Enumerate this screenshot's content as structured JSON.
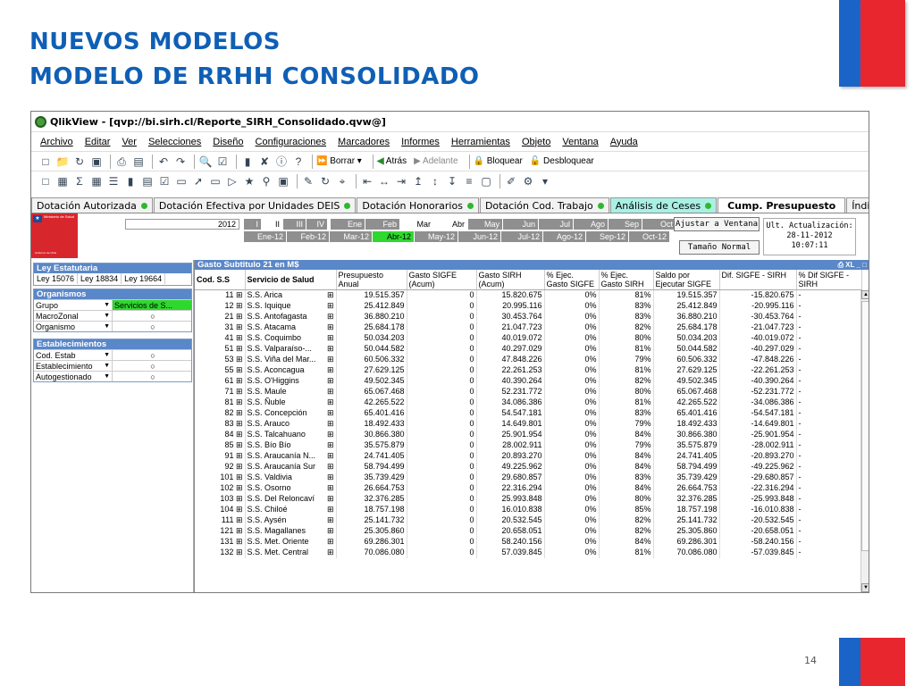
{
  "slide": {
    "title_line1": "NUEVOS MODELOS",
    "title_line2": "MODELO DE RRHH CONSOLIDADO",
    "page_number": "14"
  },
  "window": {
    "title": "QlikView - [qvp://bi.sirh.cl/Reporte_SIRH_Consolidado.qvw@]"
  },
  "menu": [
    "Archivo",
    "Editar",
    "Ver",
    "Selecciones",
    "Diseño",
    "Configuraciones",
    "Marcadores",
    "Informes",
    "Herramientas",
    "Objeto",
    "Ventana",
    "Ayuda"
  ],
  "toolbar": {
    "borrar": "Borrar",
    "atras": "Atrás",
    "adelante": "Adelante",
    "bloquear": "Bloquear",
    "desbloquear": "Desbloquear"
  },
  "tabs": [
    "Dotación Autorizada",
    "Dotación Efectiva por Unidades DEIS",
    "Dotación Honorarios",
    "Dotación Cod. Trabajo",
    "Análisis de Ceses",
    "Cump. Presupuesto",
    "Índice de Endeuda"
  ],
  "logo": {
    "text": "Ministerio de Salud",
    "footer": "Gobierno de Chile"
  },
  "filters": {
    "year": "2012",
    "quarters": [
      "I",
      "II",
      "III",
      "IV"
    ],
    "months": [
      "Ene",
      "Feb",
      "Mar",
      "Abr",
      "May",
      "Jun",
      "Jul",
      "Ago",
      "Sep",
      "Oct"
    ],
    "month_years": [
      "Ene-12",
      "Feb-12",
      "Mar-12",
      "Abr-12",
      "May-12",
      "Jun-12",
      "Jul-12",
      "Ago-12",
      "Sep-12",
      "Oct-12"
    ],
    "colors": {
      "excluded": "#8f8f8f",
      "selected": "#2ed82e",
      "possible": "#ffffff"
    }
  },
  "buttons": {
    "ajustar": "Ajustar a Ventana",
    "tamano": "Tamaño Normal"
  },
  "ult_actualizacion": {
    "label": "Ult. Actualización:",
    "date": "28-11-2012",
    "time": "10:07:11"
  },
  "ley_panel": {
    "title": "Ley Estatutaria",
    "items": [
      "Ley 15076",
      "Ley 18834",
      "Ley 19664"
    ]
  },
  "organismos_panel": {
    "title": "Organismos",
    "rows": [
      {
        "label": "Grupo",
        "value": "Servicios de S..."
      },
      {
        "label": "MacroZonal",
        "value": "○"
      },
      {
        "label": "Organismo",
        "value": "○"
      }
    ]
  },
  "establecimientos_panel": {
    "title": "Establecimientos",
    "rows": [
      {
        "label": "Cod. Estab",
        "value": "○"
      },
      {
        "label": "Establecimiento",
        "value": "○"
      },
      {
        "label": "Autogestionado",
        "value": "○"
      }
    ]
  },
  "table": {
    "caption": "Gasto Subtitulo 21 en M$",
    "headers": [
      "Cod. S.S",
      "Servicio de Salud",
      "Presupuesto Anual",
      "Gasto SIGFE (Acum)",
      "Gasto SIRH (Acum)",
      "% Ejec. Gasto SIGFE",
      "% Ejec. Gasto SIRH",
      "Saldo por Ejecutar SIGFE",
      "Dif. SIGFE - SIRH",
      "% Dif SIGFE - SIRH"
    ],
    "rows": [
      [
        "11",
        "S.S. Arica",
        "19.515.357",
        "0",
        "15.820.675",
        "0%",
        "81%",
        "19.515.357",
        "-15.820.675",
        "-"
      ],
      [
        "12",
        "S.S. Iquique",
        "25.412.849",
        "0",
        "20.995.116",
        "0%",
        "83%",
        "25.412.849",
        "-20.995.116",
        "-"
      ],
      [
        "21",
        "S.S. Antofagasta",
        "36.880.210",
        "0",
        "30.453.764",
        "0%",
        "83%",
        "36.880.210",
        "-30.453.764",
        "-"
      ],
      [
        "31",
        "S.S. Atacama",
        "25.684.178",
        "0",
        "21.047.723",
        "0%",
        "82%",
        "25.684.178",
        "-21.047.723",
        "-"
      ],
      [
        "41",
        "S.S. Coquimbo",
        "50.034.203",
        "0",
        "40.019.072",
        "0%",
        "80%",
        "50.034.203",
        "-40.019.072",
        "-"
      ],
      [
        "51",
        "S.S. Valparaíso-...",
        "50.044.582",
        "0",
        "40.297.029",
        "0%",
        "81%",
        "50.044.582",
        "-40.297.029",
        "-"
      ],
      [
        "53",
        "S.S. Viña del Mar...",
        "60.506.332",
        "0",
        "47.848.226",
        "0%",
        "79%",
        "60.506.332",
        "-47.848.226",
        "-"
      ],
      [
        "55",
        "S.S. Aconcagua",
        "27.629.125",
        "0",
        "22.261.253",
        "0%",
        "81%",
        "27.629.125",
        "-22.261.253",
        "-"
      ],
      [
        "61",
        "S.S. O'Higgins",
        "49.502.345",
        "0",
        "40.390.264",
        "0%",
        "82%",
        "49.502.345",
        "-40.390.264",
        "-"
      ],
      [
        "71",
        "S.S. Maule",
        "65.067.468",
        "0",
        "52.231.772",
        "0%",
        "80%",
        "65.067.468",
        "-52.231.772",
        "-"
      ],
      [
        "81",
        "S.S. Ñuble",
        "42.265.522",
        "0",
        "34.086.386",
        "0%",
        "81%",
        "42.265.522",
        "-34.086.386",
        "-"
      ],
      [
        "82",
        "S.S. Concepción",
        "65.401.416",
        "0",
        "54.547.181",
        "0%",
        "83%",
        "65.401.416",
        "-54.547.181",
        "-"
      ],
      [
        "83",
        "S.S. Arauco",
        "18.492.433",
        "0",
        "14.649.801",
        "0%",
        "79%",
        "18.492.433",
        "-14.649.801",
        "-"
      ],
      [
        "84",
        "S.S. Talcahuano",
        "30.866.380",
        "0",
        "25.901.954",
        "0%",
        "84%",
        "30.866.380",
        "-25.901.954",
        "-"
      ],
      [
        "85",
        "S.S. Bío Bío",
        "35.575.879",
        "0",
        "28.002.911",
        "0%",
        "79%",
        "35.575.879",
        "-28.002.911",
        "-"
      ],
      [
        "91",
        "S.S. Araucanía N...",
        "24.741.405",
        "0",
        "20.893.270",
        "0%",
        "84%",
        "24.741.405",
        "-20.893.270",
        "-"
      ],
      [
        "92",
        "S.S. Araucanía Sur",
        "58.794.499",
        "0",
        "49.225.962",
        "0%",
        "84%",
        "58.794.499",
        "-49.225.962",
        "-"
      ],
      [
        "101",
        "S.S. Valdivia",
        "35.739.429",
        "0",
        "29.680.857",
        "0%",
        "83%",
        "35.739.429",
        "-29.680.857",
        "-"
      ],
      [
        "102",
        "S.S. Osorno",
        "26.664.753",
        "0",
        "22.316.294",
        "0%",
        "84%",
        "26.664.753",
        "-22.316.294",
        "-"
      ],
      [
        "103",
        "S.S. Del Reloncaví",
        "32.376.285",
        "0",
        "25.993.848",
        "0%",
        "80%",
        "32.376.285",
        "-25.993.848",
        "-"
      ],
      [
        "104",
        "S.S. Chiloé",
        "18.757.198",
        "0",
        "16.010.838",
        "0%",
        "85%",
        "18.757.198",
        "-16.010.838",
        "-"
      ],
      [
        "111",
        "S.S. Aysén",
        "25.141.732",
        "0",
        "20.532.545",
        "0%",
        "82%",
        "25.141.732",
        "-20.532.545",
        "-"
      ],
      [
        "121",
        "S.S. Magallanes",
        "25.305.860",
        "0",
        "20.658.051",
        "0%",
        "82%",
        "25.305.860",
        "-20.658.051",
        "-"
      ],
      [
        "131",
        "S.S. Met. Oriente",
        "69.286.301",
        "0",
        "58.240.156",
        "0%",
        "84%",
        "69.286.301",
        "-58.240.156",
        "-"
      ],
      [
        "132",
        "S.S. Met. Central",
        "70.086.080",
        "0",
        "57.039.845",
        "0%",
        "81%",
        "70.086.080",
        "-57.039.845",
        "-"
      ]
    ]
  },
  "colors": {
    "title_blue": "#0f5fb5",
    "deco_blue": "#1a63c7",
    "deco_red": "#e8262e",
    "panel_header": "#5a87c8",
    "tab_highlight": "#a9f0e4"
  }
}
